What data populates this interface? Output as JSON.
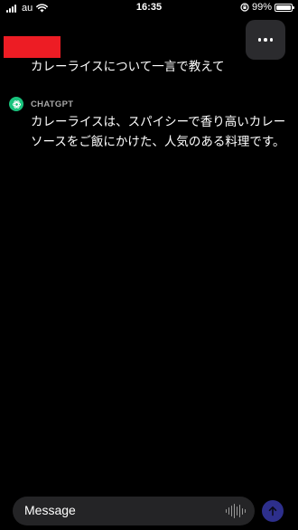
{
  "status_bar": {
    "carrier": "au",
    "time": "16:35",
    "battery": "99%",
    "battery_level": 0.99
  },
  "conversation": {
    "user_message": "カレーライスについて一言で教えて",
    "assistant_name": "CHATGPT",
    "assistant_message": "カレーライスは、スパイシーで香り高いカレーソースをご飯にかけた、人気のある料理です。"
  },
  "composer": {
    "placeholder": "Message"
  },
  "colors": {
    "background": "#000000",
    "redaction": "#ed1c24",
    "avatar": "#19c37d",
    "send_button": "#2d2f8c",
    "input_bg": "#242426"
  },
  "icons": [
    "signal-icon",
    "wifi-icon",
    "orientation-lock-icon",
    "battery-icon",
    "more-icon",
    "chatgpt-logo-icon",
    "voice-icon",
    "send-arrow-icon"
  ]
}
